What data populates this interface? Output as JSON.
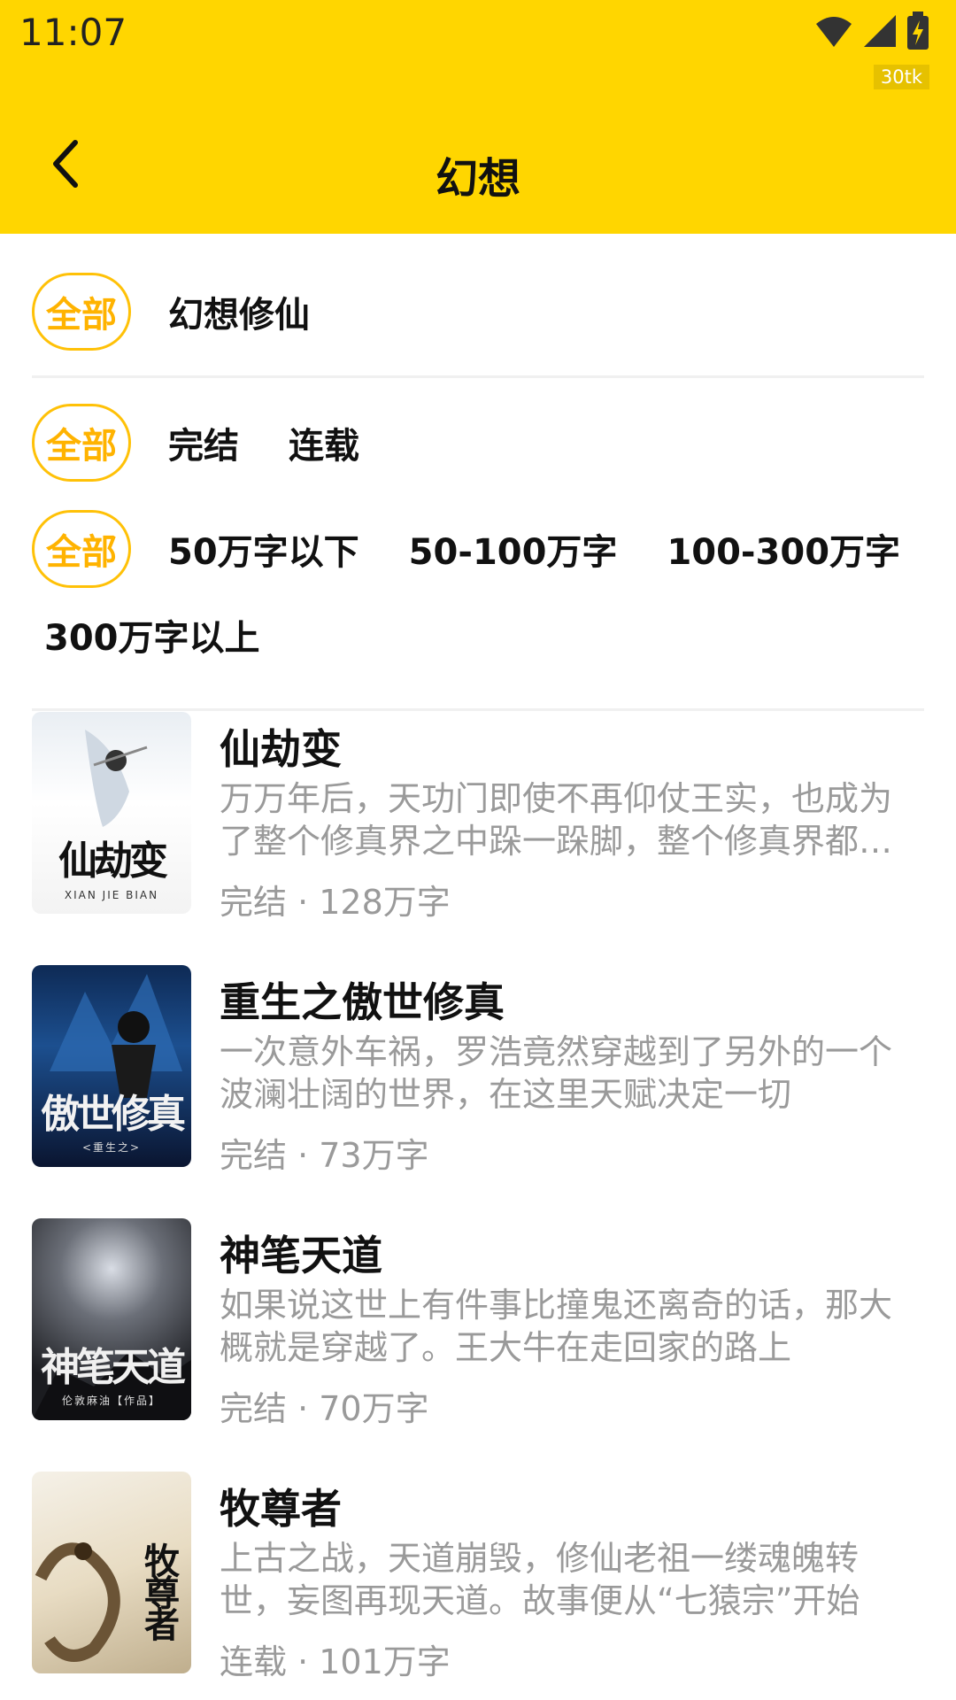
{
  "status_bar": {
    "time": "11:07",
    "badge": "30tk",
    "icons": [
      "wifi-icon",
      "signal-icon",
      "battery-charging-icon"
    ]
  },
  "header": {
    "title": "幻想",
    "back_icon": "chevron-left-icon"
  },
  "colors": {
    "brand_yellow": "#FFD600",
    "chip_border": "#FFC107",
    "chip_text": "#FFB300",
    "secondary_text": "#9a9a9a"
  },
  "filters": {
    "category": {
      "all_label": "全部",
      "options": [
        "幻想修仙"
      ]
    },
    "status": {
      "all_label": "全部",
      "options": [
        "完结",
        "连载"
      ]
    },
    "word_count": {
      "all_label": "全部",
      "options": [
        "50万字以下",
        "50-100万字",
        "100-300万字",
        "300万字以上"
      ]
    }
  },
  "books": [
    {
      "title": "仙劫变",
      "description": "万万年后，天功门即使不再仰仗王实，也成为了整个修真界之中跺一跺脚，整个修真界都要抖三抖的门派",
      "meta": "完结 · 128万字",
      "cover_title": "仙劫变",
      "cover_subtitle": "XIAN JIE BIAN"
    },
    {
      "title": "重生之傲世修真",
      "description": "一次意外车祸，罗浩竟然穿越到了另外的一个波澜壮阔的世界，在这里天赋决定一切",
      "meta": "完结 · 73万字",
      "cover_title": "傲世修真",
      "cover_subtitle": "<重生之>"
    },
    {
      "title": "神笔天道",
      "description": "如果说这世上有件事比撞鬼还离奇的话，那大概就是穿越了。王大牛在走回家的路上",
      "meta": "完结 · 70万字",
      "cover_title": "神笔天道",
      "cover_subtitle": "伦敦麻油【作品】"
    },
    {
      "title": "牧尊者",
      "description": "上古之战，天道崩毁，修仙老祖一缕魂魄转世，妄图再现天道。故事便从“七猿宗”开始",
      "meta": "连载 · 101万字",
      "cover_title": "牧尊者",
      "cover_subtitle": ""
    }
  ]
}
